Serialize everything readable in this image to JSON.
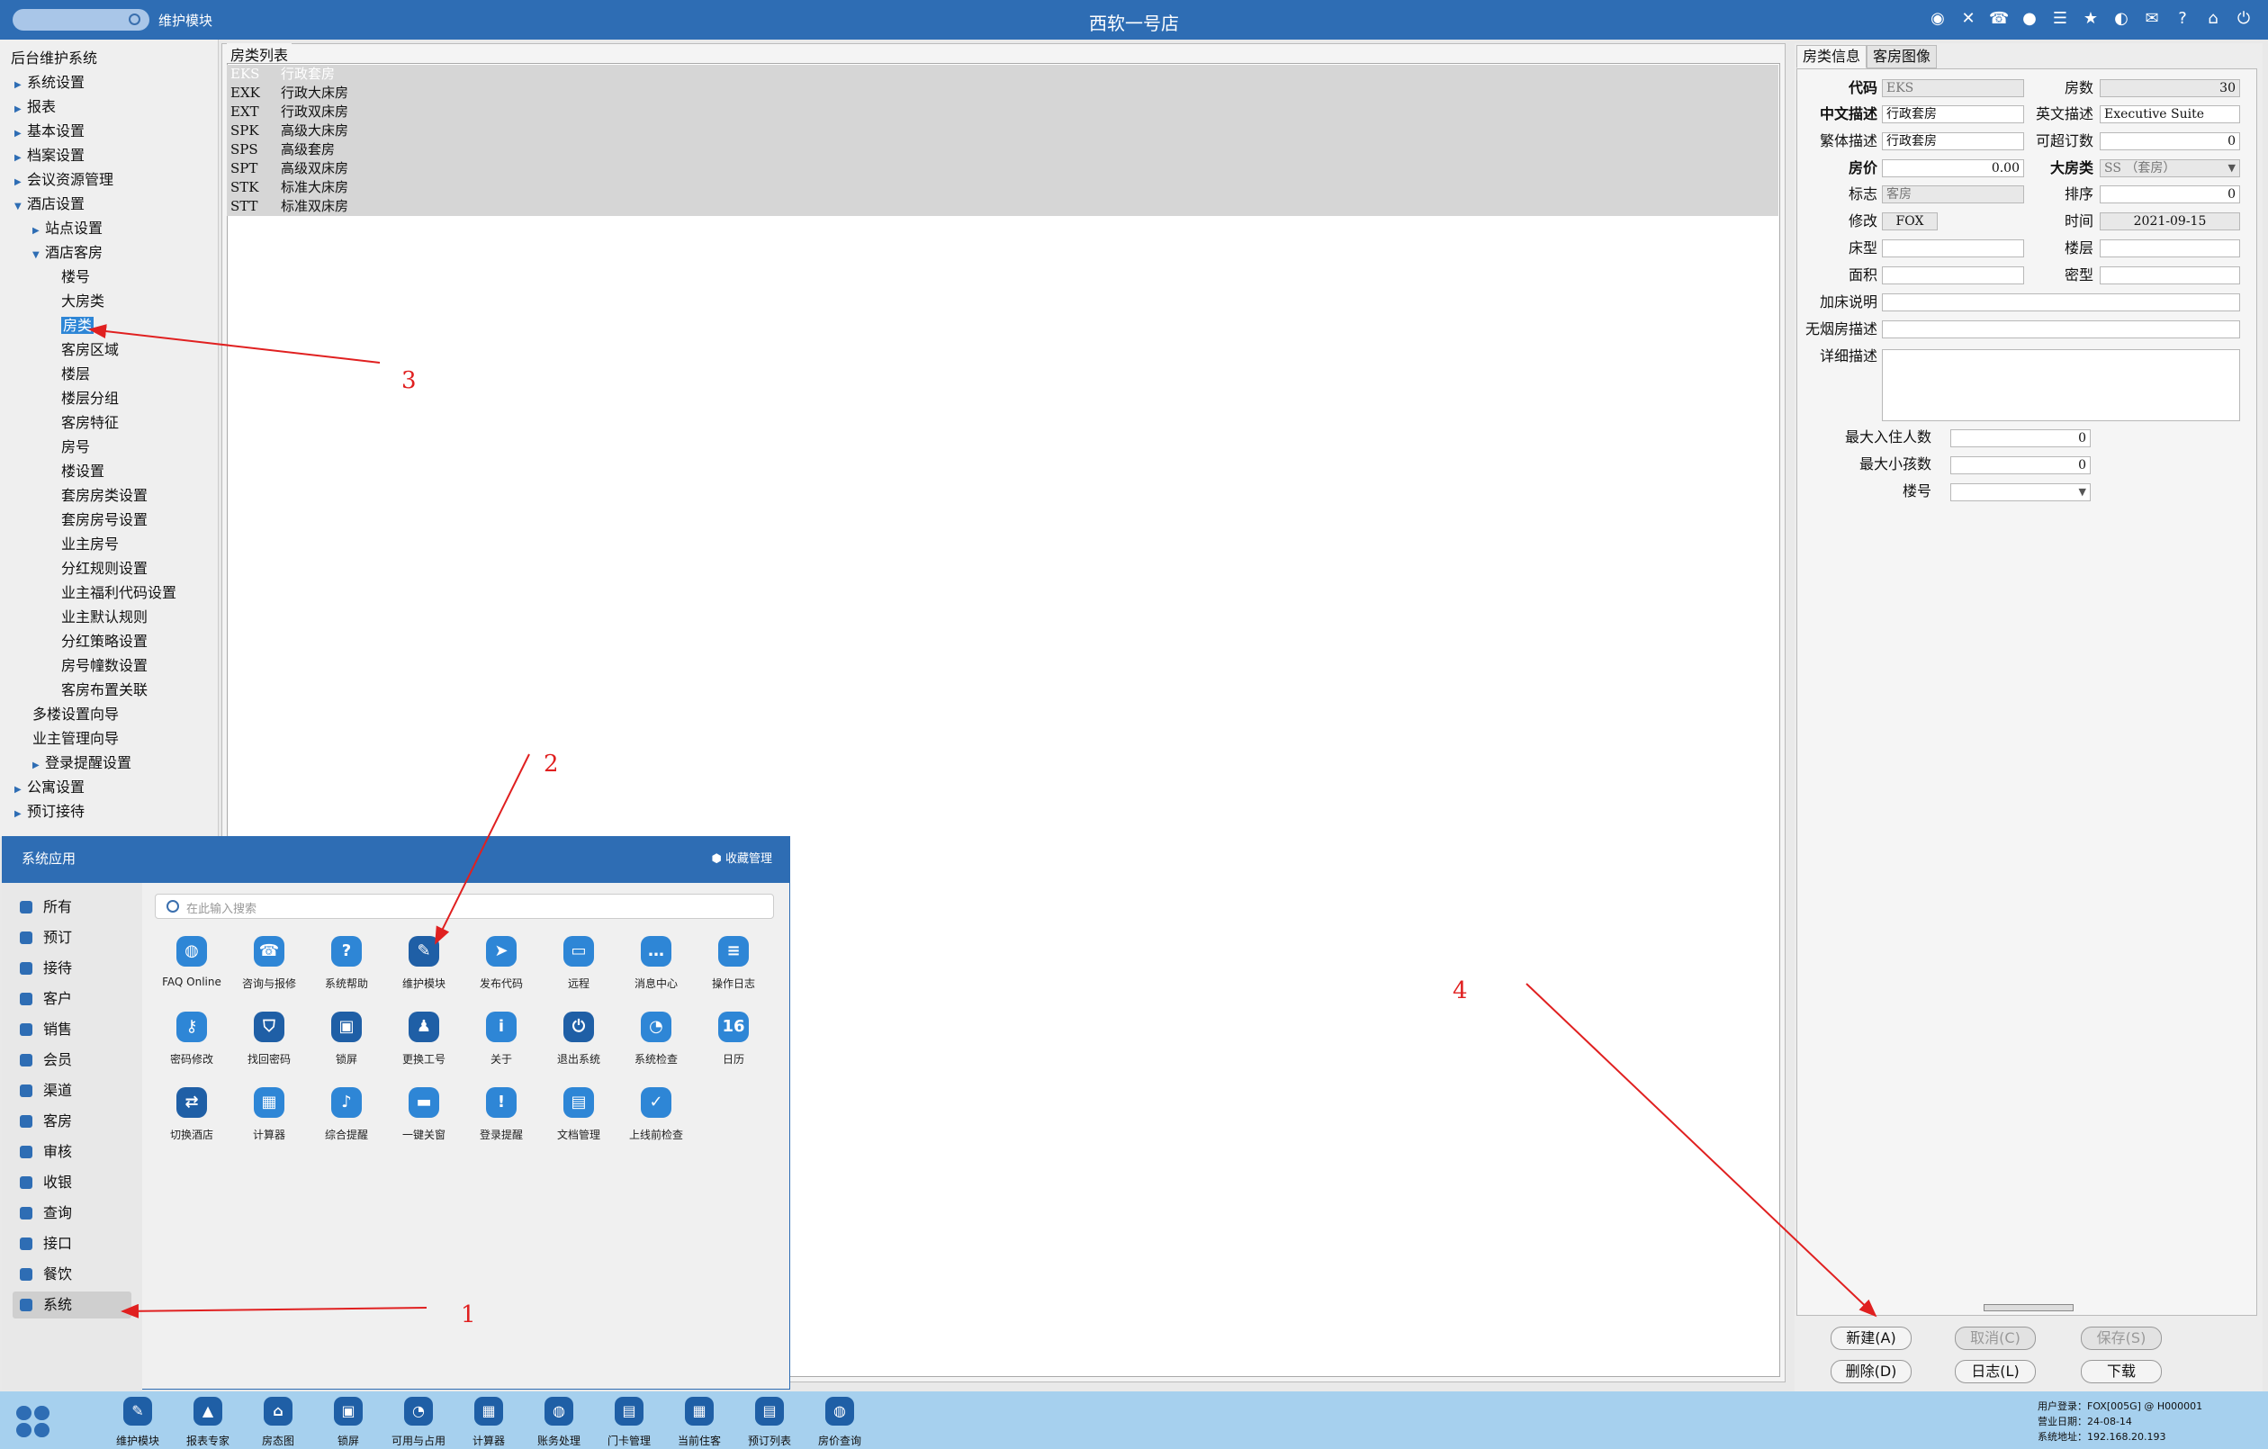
{
  "topbar": {
    "module": "维护模块",
    "title": "西软一号店",
    "icons": [
      "wifi-icon",
      "tools-icon",
      "phone-icon",
      "palette-icon",
      "menu-icon",
      "star-icon",
      "contrast-icon",
      "mail-icon",
      "help-icon",
      "home-icon",
      "close-icon"
    ]
  },
  "tree": {
    "root": "后台维护系统",
    "items": [
      {
        "label": "系统设置",
        "level": 1,
        "arrow": "right"
      },
      {
        "label": "报表",
        "level": 1,
        "arrow": "right"
      },
      {
        "label": "基本设置",
        "level": 1,
        "arrow": "right"
      },
      {
        "label": "档案设置",
        "level": 1,
        "arrow": "right"
      },
      {
        "label": "会议资源管理",
        "level": 1,
        "arrow": "right"
      },
      {
        "label": "酒店设置",
        "level": 1,
        "arrow": "down"
      },
      {
        "label": "站点设置",
        "level": 2,
        "arrow": "right"
      },
      {
        "label": "酒店客房",
        "level": 2,
        "arrow": "down"
      },
      {
        "label": "楼号",
        "level": 3
      },
      {
        "label": "大房类",
        "level": 3
      },
      {
        "label": "房类",
        "level": 3,
        "selected": true
      },
      {
        "label": "客房区域",
        "level": 3
      },
      {
        "label": "楼层",
        "level": 3
      },
      {
        "label": "楼层分组",
        "level": 3
      },
      {
        "label": "客房特征",
        "level": 3
      },
      {
        "label": "房号",
        "level": 3
      },
      {
        "label": "楼设置",
        "level": 3
      },
      {
        "label": "套房房类设置",
        "level": 3
      },
      {
        "label": "套房房号设置",
        "level": 3
      },
      {
        "label": "业主房号",
        "level": 3
      },
      {
        "label": "分红规则设置",
        "level": 3
      },
      {
        "label": "业主福利代码设置",
        "level": 3
      },
      {
        "label": "业主默认规则",
        "level": 3
      },
      {
        "label": "分红策略设置",
        "level": 3
      },
      {
        "label": "房号幢数设置",
        "level": 3
      },
      {
        "label": "客房布置关联",
        "level": 3
      },
      {
        "label": "多楼设置向导",
        "level": 2
      },
      {
        "label": "业主管理向导",
        "level": 2
      },
      {
        "label": "登录提醒设置",
        "level": 2,
        "arrow": "right"
      },
      {
        "label": "公寓设置",
        "level": 1,
        "arrow": "right"
      },
      {
        "label": "预订接待",
        "level": 1,
        "arrow": "right"
      }
    ]
  },
  "room_list": {
    "legend": "房类列表",
    "rows": [
      {
        "code": "EKS",
        "name": "行政套房",
        "selected": true
      },
      {
        "code": "EXK",
        "name": "行政大床房"
      },
      {
        "code": "EXT",
        "name": "行政双床房"
      },
      {
        "code": "SPK",
        "name": "高级大床房"
      },
      {
        "code": "SPS",
        "name": "高级套房"
      },
      {
        "code": "SPT",
        "name": "高级双床房"
      },
      {
        "code": "STK",
        "name": "标准大床房"
      },
      {
        "code": "STT",
        "name": "标准双床房"
      }
    ]
  },
  "detail": {
    "tabs": [
      "房类信息",
      "客房图像"
    ],
    "labels": {
      "code": "代码",
      "rooms": "房数",
      "cn_desc": "中文描述",
      "en_desc": "英文描述",
      "tc_desc": "繁体描述",
      "overbook": "可超订数",
      "price": "房价",
      "big_type": "大房类",
      "flag": "标志",
      "sort": "排序",
      "modify": "修改",
      "time": "时间",
      "bed_type": "床型",
      "floor": "楼层",
      "area": "面积",
      "density": "密型",
      "extra_bed": "加床说明",
      "nonsmoke": "无烟房描述",
      "detail_desc": "详细描述",
      "max_guests": "最大入住人数",
      "max_children": "最大小孩数",
      "building": "楼号"
    },
    "values": {
      "code": "EKS",
      "rooms": "30",
      "cn_desc": "行政套房",
      "en_desc": "Executive Suite",
      "tc_desc": "行政套房",
      "overbook": "0",
      "price": "0.00",
      "big_type": "SS  （套房）",
      "flag": "客房",
      "sort": "0",
      "modify": "FOX",
      "time": "2021-09-15",
      "bed_type": "",
      "floor": "",
      "area": "",
      "density": "",
      "extra_bed": "",
      "nonsmoke": "",
      "detail_desc": "",
      "max_guests": "0",
      "max_children": "0",
      "building": ""
    },
    "buttons": {
      "new": "新建(A)",
      "cancel": "取消(C)",
      "save": "保存(S)",
      "delete": "删除(D)",
      "log": "日志(L)",
      "download": "下载"
    }
  },
  "popup": {
    "title": "系统应用",
    "favorites": "收藏管理",
    "search_placeholder": "在此输入搜索",
    "categories": [
      "所有",
      "预订",
      "接待",
      "客户",
      "销售",
      "会员",
      "渠道",
      "客房",
      "审核",
      "收银",
      "查询",
      "接口",
      "餐饮",
      "系统"
    ],
    "active_category": "系统",
    "apps": [
      {
        "name": "FAQ Online",
        "icon": "chat-icon"
      },
      {
        "name": "咨询与报修",
        "icon": "phone-icon"
      },
      {
        "name": "系统帮助",
        "icon": "help-icon"
      },
      {
        "name": "维护模块",
        "icon": "wrench-icon"
      },
      {
        "name": "发布代码",
        "icon": "send-icon"
      },
      {
        "name": "远程",
        "icon": "laptop-icon"
      },
      {
        "name": "消息中心",
        "icon": "message-icon"
      },
      {
        "name": "操作日志",
        "icon": "log-icon"
      },
      {
        "name": "密码修改",
        "icon": "key-icon"
      },
      {
        "name": "找回密码",
        "icon": "shield-icon"
      },
      {
        "name": "锁屏",
        "icon": "lock-icon"
      },
      {
        "name": "更换工号",
        "icon": "user-icon"
      },
      {
        "name": "关于",
        "icon": "info-icon"
      },
      {
        "name": "退出系统",
        "icon": "power-icon"
      },
      {
        "name": "系统检查",
        "icon": "gauge-icon"
      },
      {
        "name": "日历",
        "icon": "calendar-icon"
      },
      {
        "name": "切换酒店",
        "icon": "switch-icon"
      },
      {
        "name": "计算器",
        "icon": "calculator-icon"
      },
      {
        "name": "综合提醒",
        "icon": "bell-icon"
      },
      {
        "name": "一键关窗",
        "icon": "window-icon"
      },
      {
        "name": "登录提醒",
        "icon": "alert-icon"
      },
      {
        "name": "文档管理",
        "icon": "folder-icon"
      },
      {
        "name": "上线前检查",
        "icon": "check-icon"
      }
    ]
  },
  "taskbar": {
    "apps": [
      "维护模块",
      "报表专家",
      "房态图",
      "锁屏",
      "可用与占用",
      "计算器",
      "账务处理",
      "门卡管理",
      "当前住客",
      "预订列表",
      "房价查询"
    ],
    "user_label": "用户登录：",
    "user": "FOX[005G] @ H000001",
    "date_label": "营业日期：",
    "date": "24-08-14",
    "addr_label": "系统地址：",
    "addr": "192.168.20.193"
  },
  "annotations": [
    "1",
    "2",
    "3",
    "4"
  ],
  "colors": {
    "accent": "#2e6db4",
    "annotation": "#e02020",
    "selection": "#2e86d6"
  }
}
